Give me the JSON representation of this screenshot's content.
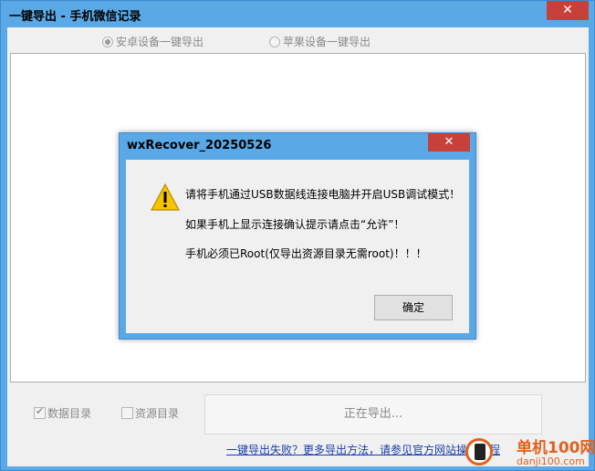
{
  "window": {
    "title": "一键导出 - 手机微信记录",
    "close_label": "✕"
  },
  "device_options": [
    {
      "label": "安卓设备一键导出",
      "selected": true
    },
    {
      "label": "苹果设备一键导出",
      "selected": false
    }
  ],
  "options": {
    "data_dir_label": "数据目录",
    "data_dir_checked": true,
    "resource_dir_label": "资源目录",
    "resource_dir_checked": false
  },
  "status": {
    "exporting": "正在导出..."
  },
  "help_link": "一键导出失败？更多导出方法，请参见官方网站操作教程",
  "dialog": {
    "title": "wxRecover_20250526",
    "close_label": "✕",
    "lines": [
      "请将手机通过USB数据线连接电脑并开启USB调试模式！",
      "如果手机上显示连接确认提示请点击“允许”！",
      "手机必须已Root(仅导出资源目录无需root)！！！"
    ],
    "ok_label": "确定"
  },
  "watermark": {
    "name": "单机100网",
    "url": "danji100.com"
  },
  "colors": {
    "titlebar": "#5aa9e6",
    "close": "#c7403a",
    "link": "#1a3ea5",
    "warning": "#f5c400"
  }
}
